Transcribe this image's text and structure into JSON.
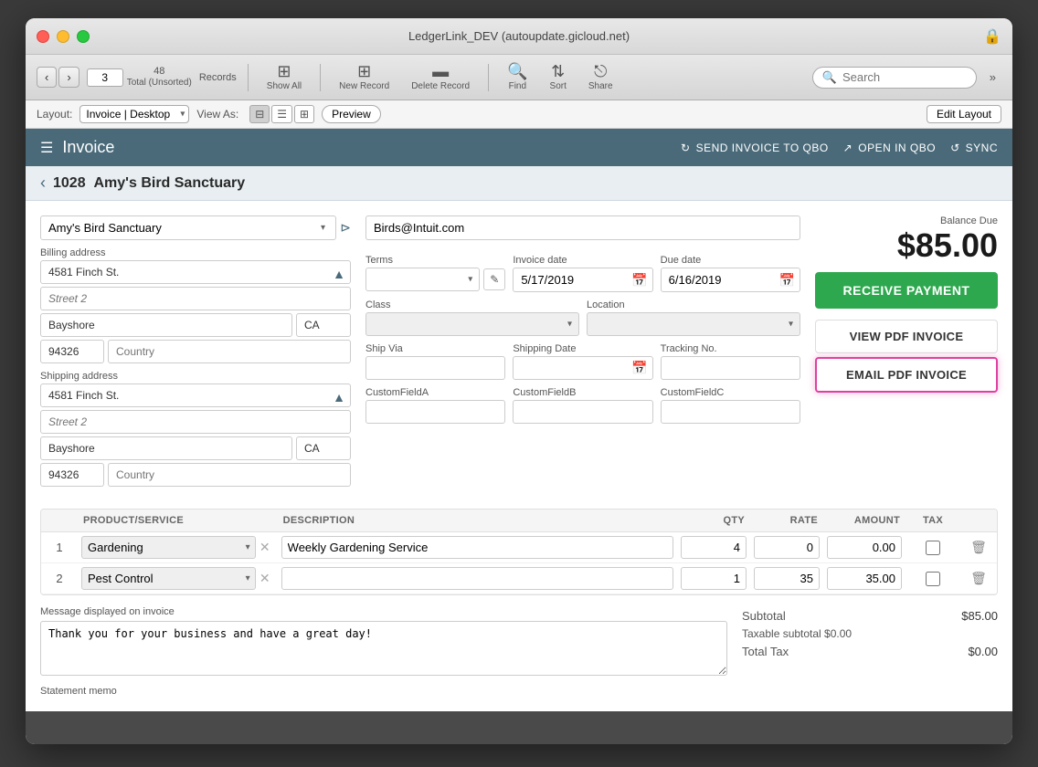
{
  "window": {
    "title": "LedgerLink_DEV (autoupdate.gicloud.net)"
  },
  "toolbar": {
    "records_count": "3",
    "total_label": "48",
    "total_sublabel": "Total (Unsorted)",
    "records_label": "Records",
    "show_all_label": "Show All",
    "new_record_label": "New Record",
    "delete_record_label": "Delete Record",
    "find_label": "Find",
    "sort_label": "Sort",
    "share_label": "Share",
    "search_placeholder": "Search",
    "more_label": "»"
  },
  "layoutbar": {
    "layout_label": "Layout:",
    "layout_value": "Invoice | Desktop",
    "view_as_label": "View As:",
    "preview_label": "Preview",
    "edit_layout_label": "Edit Layout"
  },
  "invoice_header": {
    "title": "Invoice",
    "send_label": "SEND INVOICE TO QBO",
    "open_label": "OPEN IN QBO",
    "sync_label": "SYNC"
  },
  "breadcrumb": {
    "number": "1028",
    "customer": "Amy's Bird Sanctuary"
  },
  "form": {
    "customer_value": "Amy's Bird Sanctuary",
    "email_value": "Birds@Intuit.com",
    "billing_address_label": "Billing address",
    "billing_street": "4581 Finch St.",
    "billing_street2": "",
    "billing_city": "Bayshore",
    "billing_state": "CA",
    "billing_zip": "94326",
    "billing_country": "",
    "shipping_address_label": "Shipping address",
    "shipping_street": "4581 Finch St.",
    "shipping_street2": "",
    "shipping_city": "Bayshore",
    "shipping_state": "CA",
    "shipping_zip": "94326",
    "shipping_country": "",
    "terms_label": "Terms",
    "terms_value": "",
    "invoice_date_label": "Invoice date",
    "invoice_date_value": "5/17/2019",
    "due_date_label": "Due date",
    "due_date_value": "6/16/2019",
    "class_label": "Class",
    "class_value": "",
    "location_label": "Location",
    "location_value": "",
    "ship_via_label": "Ship Via",
    "ship_via_value": "",
    "shipping_date_label": "Shipping Date",
    "shipping_date_value": "",
    "tracking_label": "Tracking No.",
    "tracking_value": "",
    "custom_a_label": "CustomFieldA",
    "custom_a_value": "",
    "custom_b_label": "CustomFieldB",
    "custom_b_value": "",
    "custom_c_label": "CustomFieldC",
    "custom_c_value": "",
    "balance_due_label": "Balance Due",
    "balance_amount": "$85.00",
    "receive_payment_label": "RECEIVE PAYMENT",
    "view_pdf_label": "VIEW PDF INVOICE",
    "email_pdf_label": "EMAIL PDF INVOICE"
  },
  "line_items": {
    "headers": {
      "product": "PRODUCT/SERVICE",
      "description": "DESCRIPTION",
      "qty": "QTY",
      "rate": "RATE",
      "amount": "AMOUNT",
      "tax": "TAX"
    },
    "rows": [
      {
        "num": "1",
        "product": "Gardening",
        "description": "Weekly Gardening Service",
        "qty": "4",
        "rate": "0",
        "amount": "0.00"
      },
      {
        "num": "2",
        "product": "Pest Control",
        "description": "",
        "qty": "1",
        "rate": "35",
        "amount": "35.00"
      }
    ]
  },
  "bottom": {
    "message_label": "Message displayed on invoice",
    "message_value": "Thank you for your business and have a great day!",
    "memo_label": "Statement memo",
    "subtotal_label": "Subtotal",
    "subtotal_value": "$85.00",
    "taxable_label": "Taxable subtotal $0.00",
    "total_tax_label": "Total Tax",
    "total_tax_value": "$0.00"
  }
}
